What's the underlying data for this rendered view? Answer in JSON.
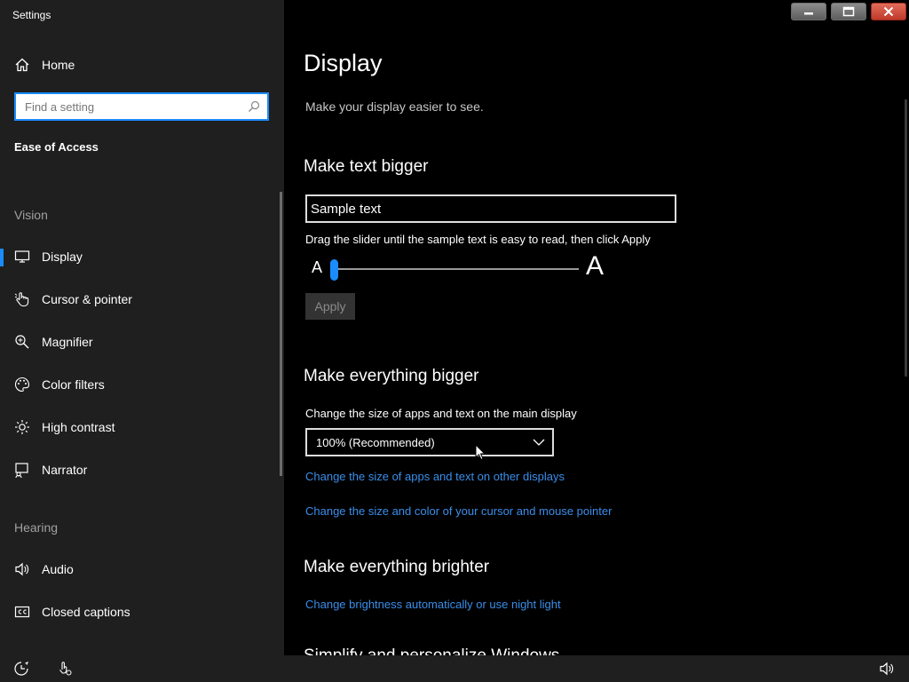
{
  "window": {
    "title": "Settings"
  },
  "sidebar": {
    "home_label": "Home",
    "search": {
      "placeholder": "Find a setting"
    },
    "section_title": "Ease of Access",
    "groups": [
      {
        "header": "Vision"
      },
      {
        "header": "Hearing"
      }
    ],
    "items": [
      {
        "label": "Display",
        "icon": "monitor-icon",
        "selected": true
      },
      {
        "label": "Cursor & pointer",
        "icon": "pointer-hand-icon"
      },
      {
        "label": "Magnifier",
        "icon": "magnifier-icon"
      },
      {
        "label": "Color filters",
        "icon": "palette-icon"
      },
      {
        "label": "High contrast",
        "icon": "sun-icon"
      },
      {
        "label": "Narrator",
        "icon": "narrator-icon"
      },
      {
        "label": "Audio",
        "icon": "speaker-icon"
      },
      {
        "label": "Closed captions",
        "icon": "cc-icon"
      }
    ]
  },
  "main": {
    "title": "Display",
    "subtitle": "Make your display easier to see.",
    "text_bigger": {
      "heading": "Make text bigger",
      "sample_text": "Sample text",
      "hint": "Drag the slider until the sample text is easy to read, then click Apply",
      "small_a": "A",
      "big_a": "A",
      "slider_value_fraction": 0.0,
      "apply_label": "Apply"
    },
    "everything_bigger": {
      "heading": "Make everything bigger",
      "label": "Change the size of apps and text on the main display",
      "dropdown_value": "100% (Recommended)",
      "link_other_displays": "Change the size of apps and text on other displays",
      "link_cursor": "Change the size and color of your cursor and mouse pointer"
    },
    "brighter": {
      "heading": "Make everything brighter",
      "link_brightness": "Change brightness automatically or use night light"
    },
    "next_heading_partial": "Simplify and personalize Windows"
  },
  "colors": {
    "accent": "#1a8cff",
    "link": "#3a8eea",
    "sidebar_bg": "#1f1f1f",
    "main_bg": "#000000"
  }
}
